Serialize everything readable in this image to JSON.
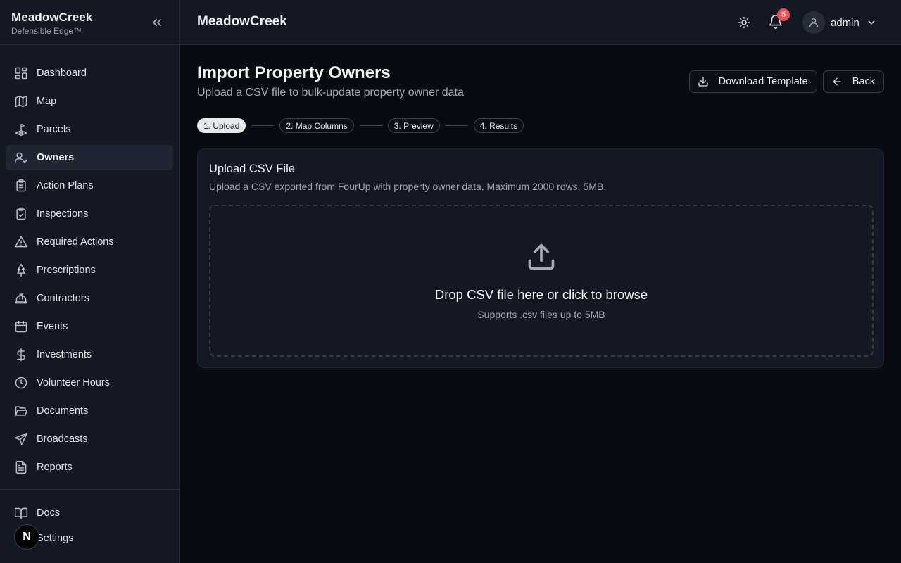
{
  "sidebar": {
    "brand_name": "MeadowCreek",
    "brand_tagline": "Defensible Edge™",
    "items": [
      {
        "label": "Dashboard",
        "icon": "dashboard-icon"
      },
      {
        "label": "Map",
        "icon": "map-icon"
      },
      {
        "label": "Parcels",
        "icon": "parcels-icon"
      },
      {
        "label": "Owners",
        "icon": "owners-icon",
        "active": true
      },
      {
        "label": "Action Plans",
        "icon": "clipboard-list-icon"
      },
      {
        "label": "Inspections",
        "icon": "clipboard-check-icon"
      },
      {
        "label": "Required Actions",
        "icon": "alert-triangle-icon"
      },
      {
        "label": "Prescriptions",
        "icon": "tree-icon"
      },
      {
        "label": "Contractors",
        "icon": "hard-hat-icon"
      },
      {
        "label": "Events",
        "icon": "calendar-icon"
      },
      {
        "label": "Investments",
        "icon": "dollar-icon"
      },
      {
        "label": "Volunteer Hours",
        "icon": "clock-icon"
      },
      {
        "label": "Documents",
        "icon": "folder-open-icon"
      },
      {
        "label": "Broadcasts",
        "icon": "send-icon"
      },
      {
        "label": "Reports",
        "icon": "file-text-icon"
      }
    ],
    "bottom_items": [
      {
        "label": "Docs",
        "icon": "book-icon"
      },
      {
        "label": "Settings",
        "icon": "settings-icon"
      }
    ],
    "n_badge": "N"
  },
  "topbar": {
    "title": "MeadowCreek",
    "notification_count": "5",
    "username": "admin"
  },
  "page": {
    "title": "Import Property Owners",
    "subtitle": "Upload a CSV file to bulk-update property owner data",
    "download_label": "Download Template",
    "back_label": "Back",
    "steps": [
      {
        "label": "1. Upload",
        "active": true
      },
      {
        "label": "2. Map Columns"
      },
      {
        "label": "3. Preview"
      },
      {
        "label": "4. Results"
      }
    ]
  },
  "upload_card": {
    "title": "Upload CSV File",
    "description": "Upload a CSV exported from FourUp with property owner data. Maximum 2000 rows, 5MB.",
    "drop_text": "Drop CSV file here or click to browse",
    "drop_subtext": "Supports .csv files up to 5MB"
  },
  "colors": {
    "background": "#090b10",
    "sidebar": "#121824",
    "notification_badge": "#e9505a",
    "active_step": "#e7e9ec"
  }
}
